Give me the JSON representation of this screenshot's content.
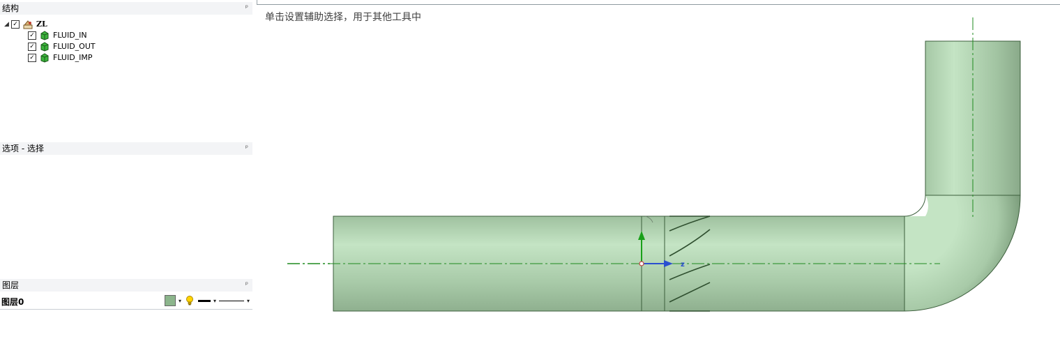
{
  "structure_panel": {
    "title": "结构",
    "pin": "ᵖ",
    "tree": {
      "root": {
        "label": "ZL",
        "checked": "✓",
        "expander": "◢"
      },
      "children": [
        {
          "label": "FLUID_IN",
          "checked": "✓"
        },
        {
          "label": "FLUID_OUT",
          "checked": "✓"
        },
        {
          "label": "FLUID_IMP",
          "checked": "✓"
        }
      ]
    }
  },
  "options_panel": {
    "title": "选项 - 选择",
    "pin": "ᵖ"
  },
  "layer_panel": {
    "title": "图层",
    "pin": "ᵖ",
    "layer": {
      "name": "图层0",
      "color": "#8cb58c"
    },
    "dropdown_glyph": "▾"
  },
  "viewport": {
    "hint": "单击设置辅助选择，用于其他工具中",
    "axis_label": "z",
    "colors": {
      "pipe": "#b9dcb9",
      "edge": "#2f4f2f",
      "centerline": "#1e8a1e",
      "axis_y": "#19a019",
      "axis_z": "#2a4fd0",
      "origin": "#c04040"
    }
  }
}
